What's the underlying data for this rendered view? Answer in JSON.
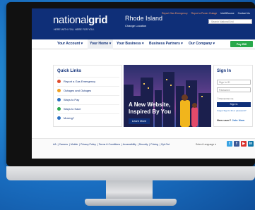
{
  "header": {
    "logo_light": "national",
    "logo_bold": "grid",
    "tagline": "HERE WITH YOU. HERE FOR YOU.",
    "state": "Rhode Island",
    "change_location": "Change Location",
    "top_links": [
      "Report Gas Emergency",
      "Report a Power Outage",
      "IntelliSource",
      "Contact Us"
    ],
    "search_placeholder": "Search NationalGrid"
  },
  "nav": {
    "items": [
      "Your Account",
      "Your Home",
      "Your Business",
      "Business Partners",
      "Our Company"
    ],
    "active_index": 1,
    "pay_bill": "Pay Bill"
  },
  "quick_links": {
    "title": "Quick Links",
    "items": [
      {
        "label": "Report a Gas Emergency",
        "color": "#e04b2b"
      },
      {
        "label": "Outages and Outages",
        "color": "#f0a020"
      },
      {
        "label": "Ways to Pay",
        "color": "#2a6fc2"
      },
      {
        "label": "Ways to Save",
        "color": "#29a94b"
      },
      {
        "label": "Moving?",
        "color": "#2a6fc2"
      }
    ]
  },
  "hero": {
    "line1": "A New Website,",
    "line2": "Inspired By You",
    "button": "Learn More"
  },
  "signin": {
    "title": "Sign In",
    "username_placeholder": "Sign In ID",
    "password_placeholder": "Password",
    "remember": "Remember me",
    "button": "Sign In",
    "forgot": "Forgot Sign In ID or password?",
    "new_user": "New user?",
    "join": "Join Now"
  },
  "footer": {
    "links": [
      "AA",
      "Careers",
      "Mobile",
      "Privacy Policy",
      "Terms & Conditions",
      "Accessibility",
      "Security",
      "Pricing",
      "Opt Out"
    ],
    "language": "Select Language",
    "social": [
      {
        "name": "twitter-icon",
        "glyph": "t",
        "color": "#3aa3e3"
      },
      {
        "name": "facebook-icon",
        "glyph": "f",
        "color": "#3b5998"
      },
      {
        "name": "youtube-icon",
        "glyph": "▶",
        "color": "#d9322d"
      },
      {
        "name": "linkedin-icon",
        "glyph": "in",
        "color": "#0e76a8"
      }
    ]
  },
  "colors": {
    "brand_navy": "#0f2f78",
    "pay_green": "#29a94b",
    "background_blue": "#1a6fc2"
  }
}
